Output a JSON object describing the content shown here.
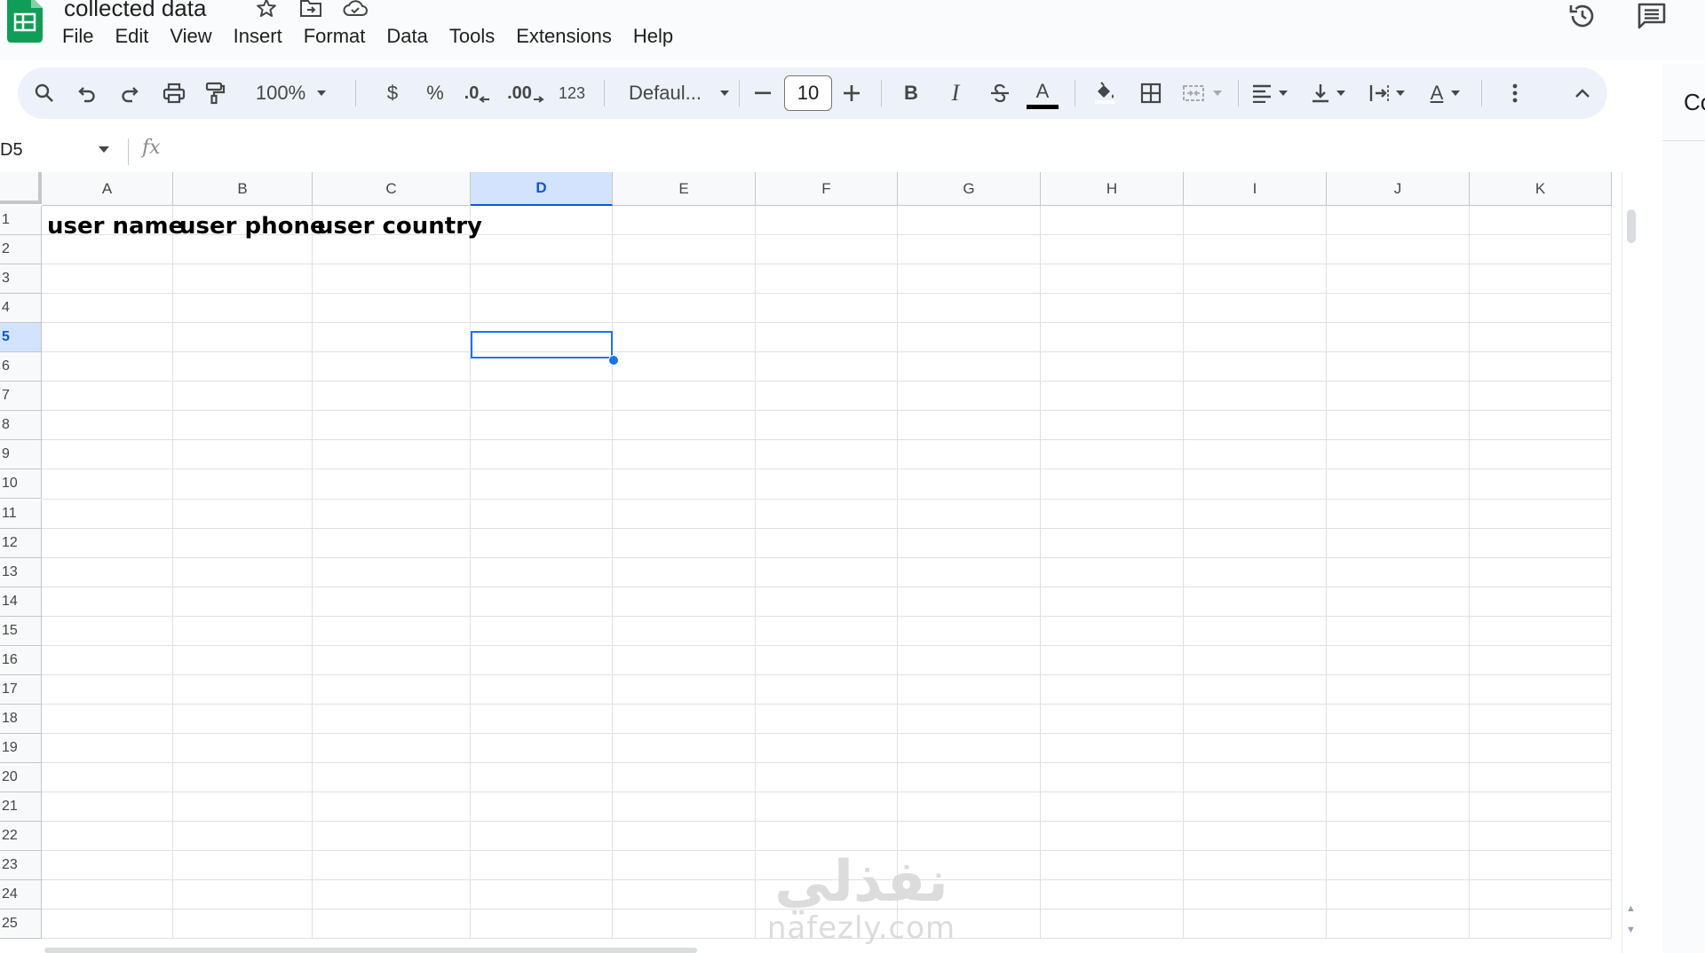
{
  "document": {
    "title": "collected data"
  },
  "menubar": {
    "items": [
      "File",
      "Edit",
      "View",
      "Insert",
      "Format",
      "Data",
      "Tools",
      "Extensions",
      "Help"
    ]
  },
  "toolbar": {
    "zoom": "100%",
    "currency_symbol": "$",
    "percent_symbol": "%",
    "decrease_decimal": ".0",
    "increase_decimal": ".00",
    "number_format": "123",
    "font_family": "Defaul...",
    "font_size": "10",
    "bold_label": "B",
    "italic_label": "I",
    "text_color_label": "A",
    "text_color": "#000000",
    "text_rotation_label": "A"
  },
  "side_panel": {
    "label": "Co"
  },
  "formula_bar": {
    "cell_ref": "D5",
    "fx_label": "fx",
    "value": ""
  },
  "grid": {
    "columns": [
      "A",
      "B",
      "C",
      "D",
      "E",
      "F",
      "G",
      "H",
      "I",
      "J",
      "K"
    ],
    "rows": [
      "1",
      "2",
      "3",
      "4",
      "5",
      "6",
      "7",
      "8",
      "9",
      "10",
      "11",
      "12",
      "13",
      "14",
      "15",
      "16",
      "17",
      "18",
      "19",
      "20",
      "21",
      "22",
      "23",
      "24",
      "25"
    ],
    "selected_column": "D",
    "selected_row": "5",
    "cells": {
      "A1": "user name",
      "B1": "user phone",
      "C1": "user country"
    }
  },
  "watermark": {
    "arabic": "نفذلي",
    "latin": "nafezly.com"
  },
  "colors": {
    "accent": "#1a73e8",
    "sheets_green": "#0f9d58",
    "selected_header_bg": "#d3e3fd",
    "toolbar_bg": "#edf2fa"
  }
}
